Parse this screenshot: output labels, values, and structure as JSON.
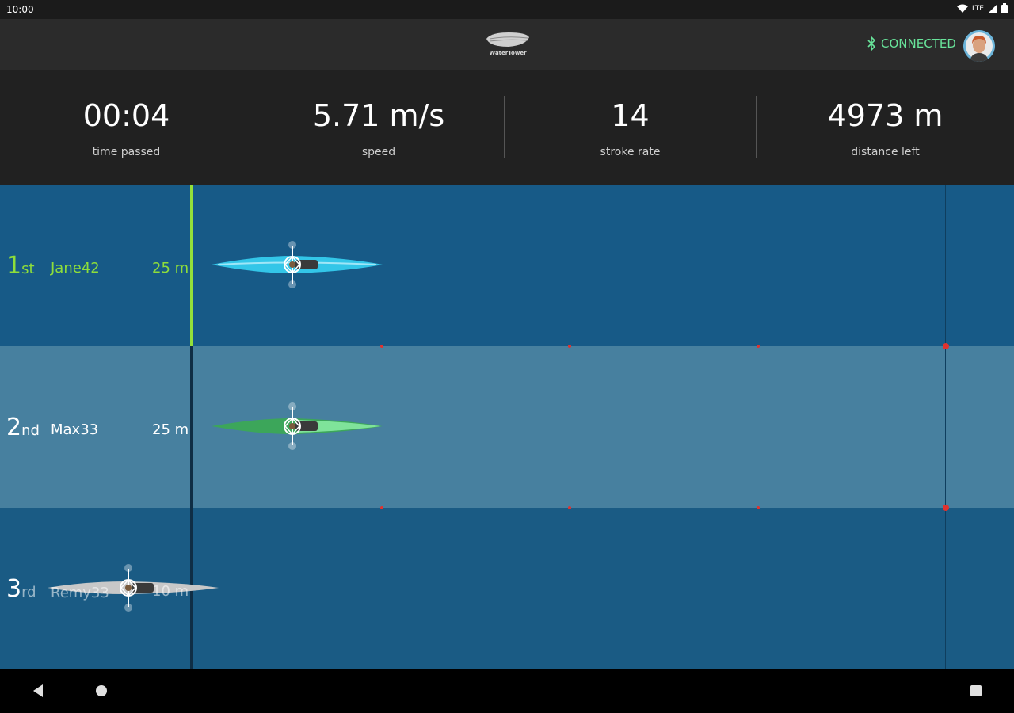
{
  "status_bar": {
    "time": "10:00",
    "network": "LTE"
  },
  "header": {
    "logo_text": "WaterTower",
    "connection_status": "CONNECTED",
    "bluetooth_icon": "bluetooth-icon",
    "avatar": "user-avatar"
  },
  "stats": [
    {
      "value": "00:04",
      "label": "time passed"
    },
    {
      "value": "5.71 m/s",
      "label": "speed"
    },
    {
      "value": "14",
      "label": "stroke rate"
    },
    {
      "value": "4973 m",
      "label": "distance left"
    }
  ],
  "lanes": [
    {
      "place": "1",
      "suffix": "st",
      "name": "Jane42",
      "distance": "25 m",
      "boat_color": "#33c6e8"
    },
    {
      "place": "2",
      "suffix": "nd",
      "name": "Max33",
      "distance": "25 m",
      "boat_color": "#3ca65a"
    },
    {
      "place": "3",
      "suffix": "rd",
      "name": "Remy33",
      "distance": "10 m",
      "boat_color": "#c8c8c8"
    }
  ],
  "colors": {
    "accent_green": "#8ede3a",
    "connected": "#68e39a",
    "marker_red": "#e0322f"
  },
  "nav": {
    "back": "back-icon",
    "home": "home-icon",
    "recents": "recents-icon"
  }
}
